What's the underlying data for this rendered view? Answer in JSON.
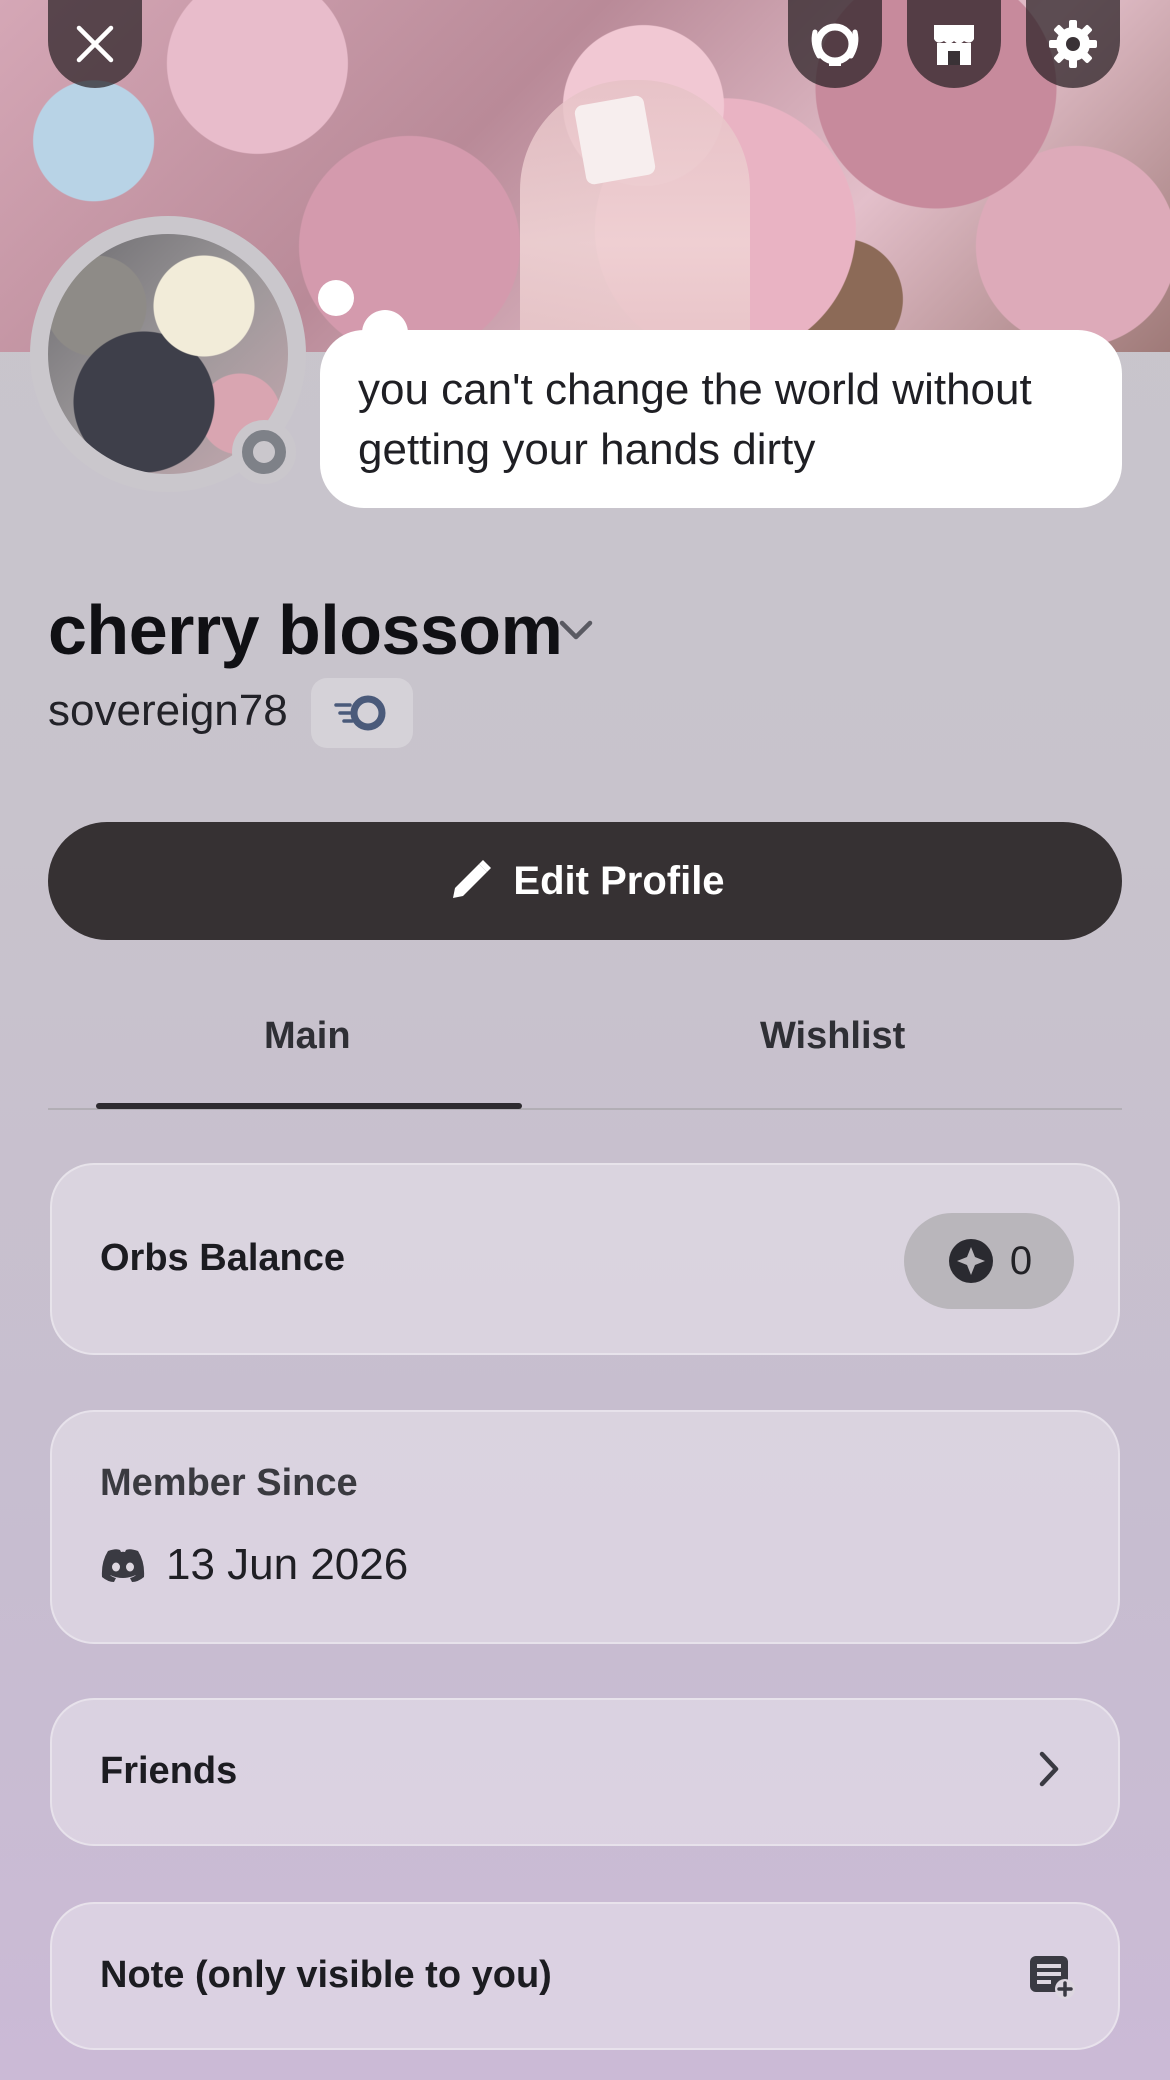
{
  "header": {
    "close_icon": "close-icon",
    "nitro_icon": "nitro-laurel-icon",
    "shop_icon": "shop-icon",
    "settings_icon": "gear-icon"
  },
  "profile": {
    "custom_status": "you can't change the world without getting your hands dirty",
    "display_name": "cherry blossom",
    "username": "sovereign78",
    "status": "idle-offline"
  },
  "actions": {
    "edit_profile_label": "Edit Profile"
  },
  "tabs": [
    {
      "label": "Main",
      "active": true
    },
    {
      "label": "Wishlist",
      "active": false
    }
  ],
  "cards": {
    "orbs": {
      "title": "Orbs Balance",
      "value": "0"
    },
    "member_since": {
      "title": "Member Since",
      "date": "13 Jun 2026"
    },
    "friends": {
      "title": "Friends"
    },
    "note": {
      "title": "Note (only visible to you)"
    }
  },
  "colors": {
    "primary_button": "#363133",
    "background": "#c8c3cc"
  }
}
